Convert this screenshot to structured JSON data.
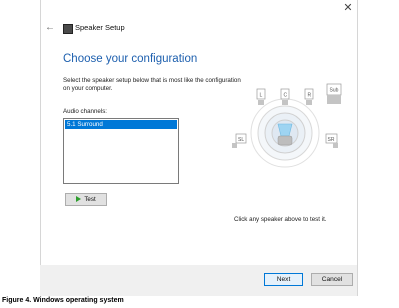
{
  "window": {
    "title": "Speaker Setup",
    "close_glyph": "✕",
    "back_glyph": "←"
  },
  "main": {
    "heading": "Choose your configuration",
    "description": "Select the speaker setup below that is most like the configuration on your computer.",
    "channels_label": "Audio channels:",
    "channels": [
      "5.1 Surround"
    ],
    "selected_channel": "5.1 Surround",
    "test_label": "Test",
    "hint": "Click any speaker above to test it."
  },
  "speakers": {
    "L": "L",
    "C": "C",
    "R": "R",
    "Sub": "Sub",
    "SL": "SL",
    "SR": "SR"
  },
  "footer": {
    "next_label": "Next",
    "cancel_label": "Cancel"
  },
  "caption": "Figure 4.  Windows operating system",
  "colors": {
    "accent": "#0078d7",
    "heading": "#1d5fae"
  },
  "icons": {
    "close": "close-icon",
    "back": "back-arrow-icon",
    "app": "speaker-app-icon",
    "test": "play-icon"
  }
}
